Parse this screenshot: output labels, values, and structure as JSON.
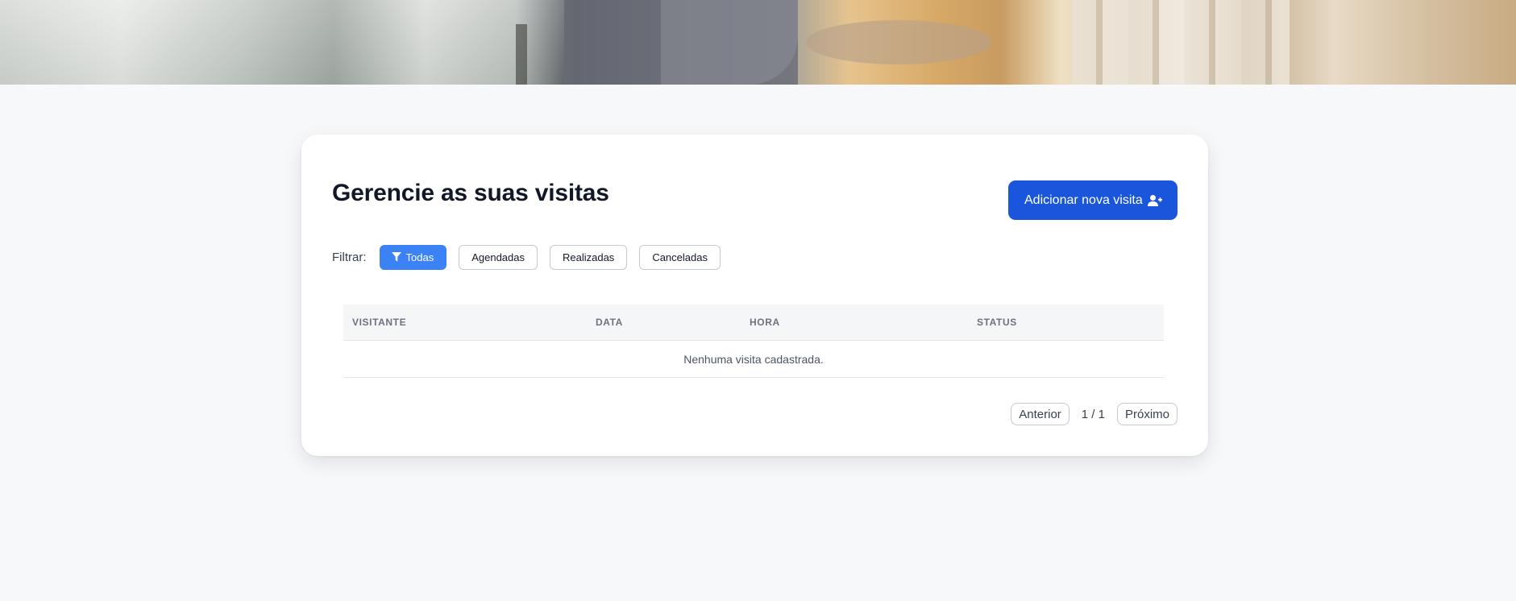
{
  "header": {
    "hero_image": "people-at-home-banner"
  },
  "main": {
    "title": "Gerencie as suas visitas",
    "add_button": {
      "label": "Adicionar nova visita",
      "icon": "user-plus-icon"
    },
    "filter": {
      "label": "Filtrar:",
      "options": [
        {
          "label": "Todas",
          "active": true,
          "icon": "filter-icon"
        },
        {
          "label": "Agendadas",
          "active": false
        },
        {
          "label": "Realizadas",
          "active": false
        },
        {
          "label": "Canceladas",
          "active": false
        }
      ]
    },
    "table": {
      "columns": [
        "VISITANTE",
        "DATA",
        "HORA",
        "STATUS"
      ],
      "rows": [],
      "empty_message": "Nenhuma visita cadastrada."
    },
    "pagination": {
      "prev_label": "Anterior",
      "page_info": "1 / 1",
      "next_label": "Próximo"
    }
  },
  "colors": {
    "primary": "#1a56db",
    "filter_active": "#3b82f6",
    "background": "#f7f8fa"
  }
}
